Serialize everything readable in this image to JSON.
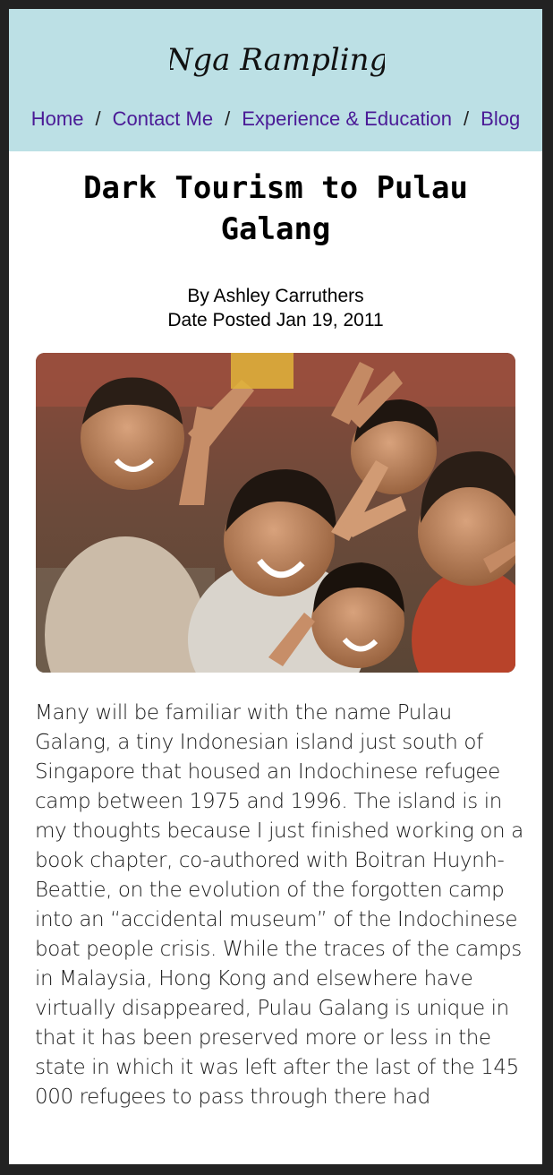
{
  "site": {
    "logo_text": "Nga Rampling"
  },
  "nav": {
    "items": [
      {
        "label": "Home"
      },
      {
        "label": "Contact Me"
      },
      {
        "label": "Experience & Education"
      },
      {
        "label": "Blog"
      }
    ],
    "separator": "/"
  },
  "article": {
    "title": "Dark Tourism to Pulau Galang",
    "byline": "By Ashley Carruthers",
    "date_line": "Date Posted Jan 19, 2011",
    "image_alt": "Group of smiling children making peace signs",
    "body": "Many will be familiar with the name Pulau Galang, a tiny Indonesian island just south of Singapore that housed an Indochinese refugee camp between 1975 and 1996. The island is in my thoughts because I just finished working on a book chapter, co-authored with Boitran Huynh-Beattie, on the evolution of the forgotten camp into an “accidental museum” of the Indochinese boat people crisis. While the traces of the camps in Malaysia, Hong Kong and elsewhere have virtually disappeared, Pulau Galang is unique in that it has been preserved more or less in the state in which it was left after the last of the 145 000 refugees to pass through there had"
  },
  "colors": {
    "header_bg": "#bce0e5",
    "nav_link": "#4a1a96",
    "page_bg": "#ffffff",
    "outer_bg": "#222222"
  }
}
